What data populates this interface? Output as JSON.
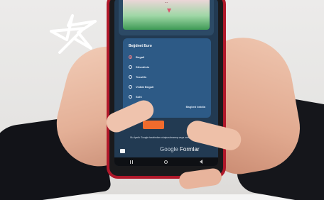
{
  "form": {
    "header_text": "...",
    "question": "Beğdnet Euro",
    "options": [
      "Bngali",
      "Stivodinis",
      "Tocutils",
      "Vedlat Bngali",
      "Sohi"
    ],
    "selected_index": 0,
    "clear_label": "Bagked bstdla"
  },
  "footer": {
    "note": "Bu İçerik Google tarafından oluşturulmamış veya onaylanmamıştır.",
    "brand_google": "Google",
    "brand_forms": "Formlar"
  },
  "colors": {
    "phone_case": "#b0182a",
    "form_card": "#2d5a86",
    "selected_radio": "#f07b83",
    "orange_button": "#f06b2d"
  },
  "icons": {
    "nav_recents": "recents-icon",
    "nav_home": "home-icon",
    "nav_back": "back-icon",
    "report": "report-icon",
    "decoration": "star-doodle-icon"
  }
}
